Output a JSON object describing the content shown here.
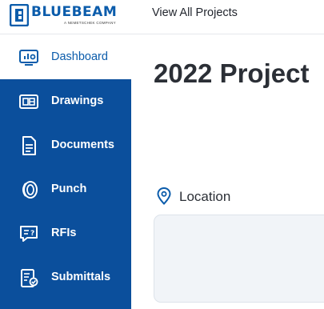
{
  "header": {
    "brand_name": "BLUEBEAM",
    "brand_tagline": "A NEMETSCHEK COMPANY",
    "view_all_projects": "View All Projects"
  },
  "sidebar": {
    "items": [
      {
        "label": "Dashboard",
        "icon": "dashboard-icon",
        "active": true
      },
      {
        "label": "Drawings",
        "icon": "drawings-icon",
        "active": false
      },
      {
        "label": "Documents",
        "icon": "documents-icon",
        "active": false
      },
      {
        "label": "Punch",
        "icon": "punch-icon",
        "active": false
      },
      {
        "label": "RFIs",
        "icon": "rfis-icon",
        "active": false
      },
      {
        "label": "Submittals",
        "icon": "submittals-icon",
        "active": false
      }
    ]
  },
  "main": {
    "title": "2022 Project",
    "location": {
      "label": "Location",
      "icon": "location-pin-icon",
      "value": ""
    }
  },
  "colors": {
    "brand_blue": "#0b5cab",
    "sidebar_blue": "#0b4f9c",
    "title_text": "#2b2f36",
    "field_bg": "#f1f4f8"
  }
}
